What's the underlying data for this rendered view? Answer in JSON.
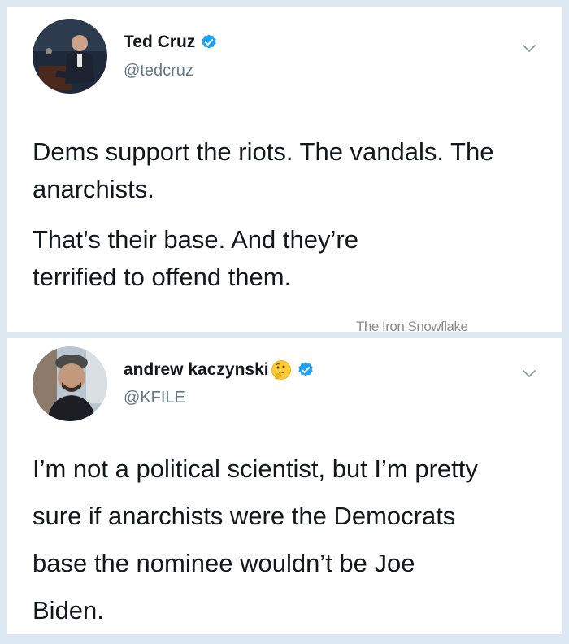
{
  "tweets": [
    {
      "name": "Ted Cruz",
      "handle": "@tedcruz",
      "verified": true,
      "paragraphs": [
        "Dems support the riots. The vandals. The anarchists.",
        "That’s their base. And they’re terrified to offend them."
      ]
    },
    {
      "name": "andrew kaczynski",
      "handle": "@KFILE",
      "verified": true,
      "name_emoji": "thinking-face-icon",
      "paragraphs": [
        "I’m not a political scientist, but I’m pretty sure if anarchists were the Democrats base the nominee wouldn’t be Joe Biden."
      ]
    }
  ],
  "watermark": "The Iron Snowflake",
  "colors": {
    "background": "#dce8f2",
    "card": "#ffffff",
    "verified_blue": "#1da1f2",
    "text": "#14171a",
    "secondary_text": "#657786"
  }
}
